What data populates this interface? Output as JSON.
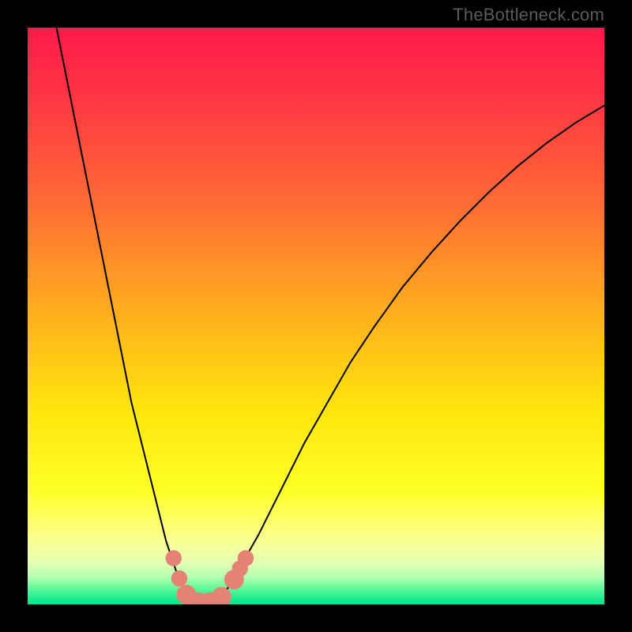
{
  "watermark": "TheBottleneck.com",
  "chart_data": {
    "type": "line",
    "title": "",
    "xlabel": "",
    "ylabel": "",
    "xlim": [
      0,
      100
    ],
    "ylim": [
      0,
      100
    ],
    "grid": false,
    "legend": false,
    "gradient_stops": [
      {
        "offset": 0.0,
        "color": "#ff1a4b"
      },
      {
        "offset": 0.12,
        "color": "#ff3544"
      },
      {
        "offset": 0.3,
        "color": "#ff6a35"
      },
      {
        "offset": 0.5,
        "color": "#ffb01c"
      },
      {
        "offset": 0.66,
        "color": "#ffe40d"
      },
      {
        "offset": 0.8,
        "color": "#ffff24"
      },
      {
        "offset": 0.885,
        "color": "#fbff8c"
      },
      {
        "offset": 0.925,
        "color": "#e7ffb1"
      },
      {
        "offset": 0.952,
        "color": "#b6ffb0"
      },
      {
        "offset": 0.975,
        "color": "#55f79a"
      },
      {
        "offset": 0.992,
        "color": "#1ae88e"
      },
      {
        "offset": 1.0,
        "color": "#18e28b"
      }
    ],
    "series": [
      {
        "name": "bottleneck-curve",
        "x": [
          5,
          6,
          7,
          8,
          9,
          10,
          11,
          12,
          13,
          14,
          15,
          16,
          17,
          18,
          19,
          20,
          21,
          22,
          23,
          24,
          25,
          26,
          27,
          28,
          29,
          30,
          31,
          32,
          33,
          34,
          35,
          36,
          38,
          40,
          42,
          45,
          48,
          52,
          56,
          60,
          65,
          70,
          75,
          80,
          85,
          90,
          95,
          100
        ],
        "y": [
          100,
          95,
          90,
          85,
          80,
          75,
          70,
          65,
          60,
          55,
          50,
          45,
          40,
          35,
          31,
          27,
          23,
          19,
          15,
          11,
          8,
          5,
          3,
          1.5,
          0.5,
          0,
          0,
          0.3,
          1,
          2,
          3.2,
          5,
          8.5,
          12,
          16,
          22,
          28,
          35,
          42,
          48,
          55,
          61,
          66.5,
          71.5,
          76,
          80,
          83.5,
          86.5
        ]
      }
    ],
    "markers": [
      {
        "x": 25.3,
        "y": 8.0,
        "r": 1.4
      },
      {
        "x": 26.3,
        "y": 4.5,
        "r": 1.4
      },
      {
        "x": 27.5,
        "y": 1.7,
        "r": 1.7
      },
      {
        "x": 29.5,
        "y": 0.4,
        "r": 1.7
      },
      {
        "x": 31.5,
        "y": 0.4,
        "r": 1.7
      },
      {
        "x": 33.6,
        "y": 1.3,
        "r": 1.7
      },
      {
        "x": 35.8,
        "y": 4.3,
        "r": 1.7
      },
      {
        "x": 36.8,
        "y": 6.2,
        "r": 1.4
      },
      {
        "x": 37.8,
        "y": 8.0,
        "r": 1.4
      }
    ]
  }
}
